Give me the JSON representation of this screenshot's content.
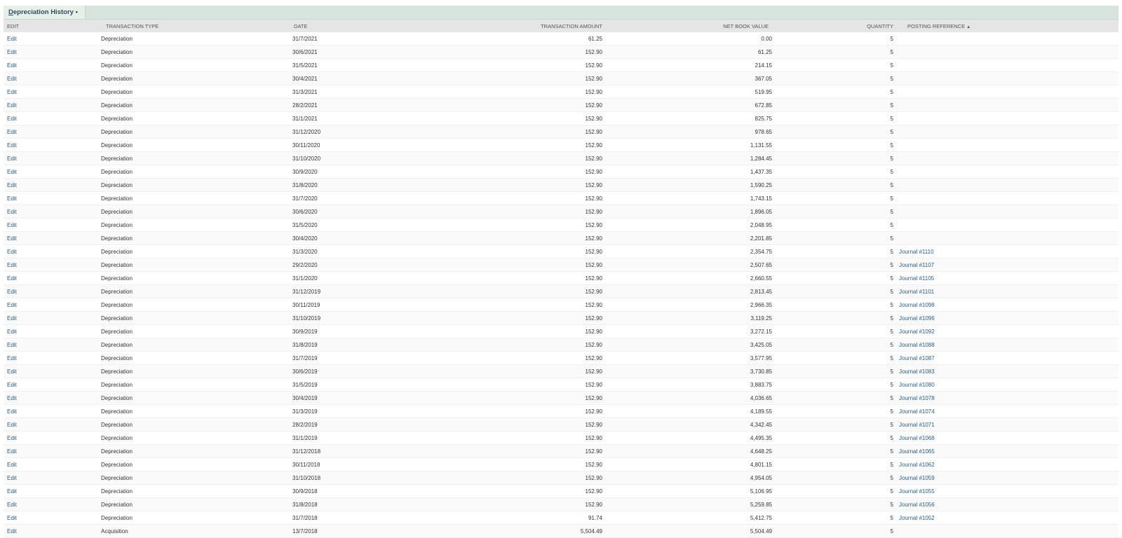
{
  "panel": {
    "tab_first_letter": "D",
    "tab_rest": "epreciation History",
    "tab_marker": "•"
  },
  "columns": {
    "edit": "EDIT",
    "type": "TRANSACTION TYPE",
    "date": "DATE",
    "amount": "TRANSACTION AMOUNT",
    "nbv": "NET BOOK VALUE",
    "qty": "QUANTITY",
    "ref": "POSTING REFERENCE",
    "ref_sort_icon": "▲"
  },
  "rows": [
    {
      "edit": "Edit",
      "type": "Depreciation",
      "date": "31/7/2021",
      "amount": "61.25",
      "nbv": "0.00",
      "qty": "5",
      "ref": ""
    },
    {
      "edit": "Edit",
      "type": "Depreciation",
      "date": "30/6/2021",
      "amount": "152.90",
      "nbv": "61.25",
      "qty": "5",
      "ref": ""
    },
    {
      "edit": "Edit",
      "type": "Depreciation",
      "date": "31/5/2021",
      "amount": "152.90",
      "nbv": "214.15",
      "qty": "5",
      "ref": ""
    },
    {
      "edit": "Edit",
      "type": "Depreciation",
      "date": "30/4/2021",
      "amount": "152.90",
      "nbv": "367.05",
      "qty": "5",
      "ref": ""
    },
    {
      "edit": "Edit",
      "type": "Depreciation",
      "date": "31/3/2021",
      "amount": "152.90",
      "nbv": "519.95",
      "qty": "5",
      "ref": ""
    },
    {
      "edit": "Edit",
      "type": "Depreciation",
      "date": "28/2/2021",
      "amount": "152.90",
      "nbv": "672.85",
      "qty": "5",
      "ref": ""
    },
    {
      "edit": "Edit",
      "type": "Depreciation",
      "date": "31/1/2021",
      "amount": "152.90",
      "nbv": "825.75",
      "qty": "5",
      "ref": ""
    },
    {
      "edit": "Edit",
      "type": "Depreciation",
      "date": "31/12/2020",
      "amount": "152.90",
      "nbv": "978.65",
      "qty": "5",
      "ref": ""
    },
    {
      "edit": "Edit",
      "type": "Depreciation",
      "date": "30/11/2020",
      "amount": "152.90",
      "nbv": "1,131.55",
      "qty": "5",
      "ref": ""
    },
    {
      "edit": "Edit",
      "type": "Depreciation",
      "date": "31/10/2020",
      "amount": "152.90",
      "nbv": "1,284.45",
      "qty": "5",
      "ref": ""
    },
    {
      "edit": "Edit",
      "type": "Depreciation",
      "date": "30/9/2020",
      "amount": "152.90",
      "nbv": "1,437.35",
      "qty": "5",
      "ref": ""
    },
    {
      "edit": "Edit",
      "type": "Depreciation",
      "date": "31/8/2020",
      "amount": "152.90",
      "nbv": "1,590.25",
      "qty": "5",
      "ref": ""
    },
    {
      "edit": "Edit",
      "type": "Depreciation",
      "date": "31/7/2020",
      "amount": "152.90",
      "nbv": "1,743.15",
      "qty": "5",
      "ref": ""
    },
    {
      "edit": "Edit",
      "type": "Depreciation",
      "date": "30/6/2020",
      "amount": "152.90",
      "nbv": "1,896.05",
      "qty": "5",
      "ref": ""
    },
    {
      "edit": "Edit",
      "type": "Depreciation",
      "date": "31/5/2020",
      "amount": "152.90",
      "nbv": "2,048.95",
      "qty": "5",
      "ref": ""
    },
    {
      "edit": "Edit",
      "type": "Depreciation",
      "date": "30/4/2020",
      "amount": "152.90",
      "nbv": "2,201.85",
      "qty": "5",
      "ref": ""
    },
    {
      "edit": "Edit",
      "type": "Depreciation",
      "date": "31/3/2020",
      "amount": "152.90",
      "nbv": "2,354.75",
      "qty": "5",
      "ref": "Journal #1110"
    },
    {
      "edit": "Edit",
      "type": "Depreciation",
      "date": "29/2/2020",
      "amount": "152.90",
      "nbv": "2,507.65",
      "qty": "5",
      "ref": "Journal #1107"
    },
    {
      "edit": "Edit",
      "type": "Depreciation",
      "date": "31/1/2020",
      "amount": "152.90",
      "nbv": "2,660.55",
      "qty": "5",
      "ref": "Journal #1105"
    },
    {
      "edit": "Edit",
      "type": "Depreciation",
      "date": "31/12/2019",
      "amount": "152.90",
      "nbv": "2,813.45",
      "qty": "5",
      "ref": "Journal #1101"
    },
    {
      "edit": "Edit",
      "type": "Depreciation",
      "date": "30/11/2019",
      "amount": "152.90",
      "nbv": "2,966.35",
      "qty": "5",
      "ref": "Journal #1098"
    },
    {
      "edit": "Edit",
      "type": "Depreciation",
      "date": "31/10/2019",
      "amount": "152.90",
      "nbv": "3,119.25",
      "qty": "5",
      "ref": "Journal #1096"
    },
    {
      "edit": "Edit",
      "type": "Depreciation",
      "date": "30/9/2019",
      "amount": "152.90",
      "nbv": "3,272.15",
      "qty": "5",
      "ref": "Journal #1092"
    },
    {
      "edit": "Edit",
      "type": "Depreciation",
      "date": "31/8/2019",
      "amount": "152.90",
      "nbv": "3,425.05",
      "qty": "5",
      "ref": "Journal #1088"
    },
    {
      "edit": "Edit",
      "type": "Depreciation",
      "date": "31/7/2019",
      "amount": "152.90",
      "nbv": "3,577.95",
      "qty": "5",
      "ref": "Journal #1087"
    },
    {
      "edit": "Edit",
      "type": "Depreciation",
      "date": "30/6/2019",
      "amount": "152.90",
      "nbv": "3,730.85",
      "qty": "5",
      "ref": "Journal #1083"
    },
    {
      "edit": "Edit",
      "type": "Depreciation",
      "date": "31/5/2019",
      "amount": "152.90",
      "nbv": "3,883.75",
      "qty": "5",
      "ref": "Journal #1080"
    },
    {
      "edit": "Edit",
      "type": "Depreciation",
      "date": "30/4/2019",
      "amount": "152.90",
      "nbv": "4,036.65",
      "qty": "5",
      "ref": "Journal #1078"
    },
    {
      "edit": "Edit",
      "type": "Depreciation",
      "date": "31/3/2019",
      "amount": "152.90",
      "nbv": "4,189.55",
      "qty": "5",
      "ref": "Journal #1074"
    },
    {
      "edit": "Edit",
      "type": "Depreciation",
      "date": "28/2/2019",
      "amount": "152.90",
      "nbv": "4,342.45",
      "qty": "5",
      "ref": "Journal #1071"
    },
    {
      "edit": "Edit",
      "type": "Depreciation",
      "date": "31/1/2019",
      "amount": "152.90",
      "nbv": "4,495.35",
      "qty": "5",
      "ref": "Journal #1068"
    },
    {
      "edit": "Edit",
      "type": "Depreciation",
      "date": "31/12/2018",
      "amount": "152.90",
      "nbv": "4,648.25",
      "qty": "5",
      "ref": "Journal #1065"
    },
    {
      "edit": "Edit",
      "type": "Depreciation",
      "date": "30/11/2018",
      "amount": "152.90",
      "nbv": "4,801.15",
      "qty": "5",
      "ref": "Journal #1062"
    },
    {
      "edit": "Edit",
      "type": "Depreciation",
      "date": "31/10/2018",
      "amount": "152.90",
      "nbv": "4,954.05",
      "qty": "5",
      "ref": "Journal #1059"
    },
    {
      "edit": "Edit",
      "type": "Depreciation",
      "date": "30/9/2018",
      "amount": "152.90",
      "nbv": "5,106.95",
      "qty": "5",
      "ref": "Journal #1055"
    },
    {
      "edit": "Edit",
      "type": "Depreciation",
      "date": "31/8/2018",
      "amount": "152.90",
      "nbv": "5,259.85",
      "qty": "5",
      "ref": "Journal #1056"
    },
    {
      "edit": "Edit",
      "type": "Depreciation",
      "date": "31/7/2018",
      "amount": "91.74",
      "nbv": "5,412.75",
      "qty": "5",
      "ref": "Journal #1052"
    },
    {
      "edit": "Edit",
      "type": "Acquisition",
      "date": "13/7/2018",
      "amount": "5,504.49",
      "nbv": "5,504.49",
      "qty": "5",
      "ref": ""
    }
  ]
}
